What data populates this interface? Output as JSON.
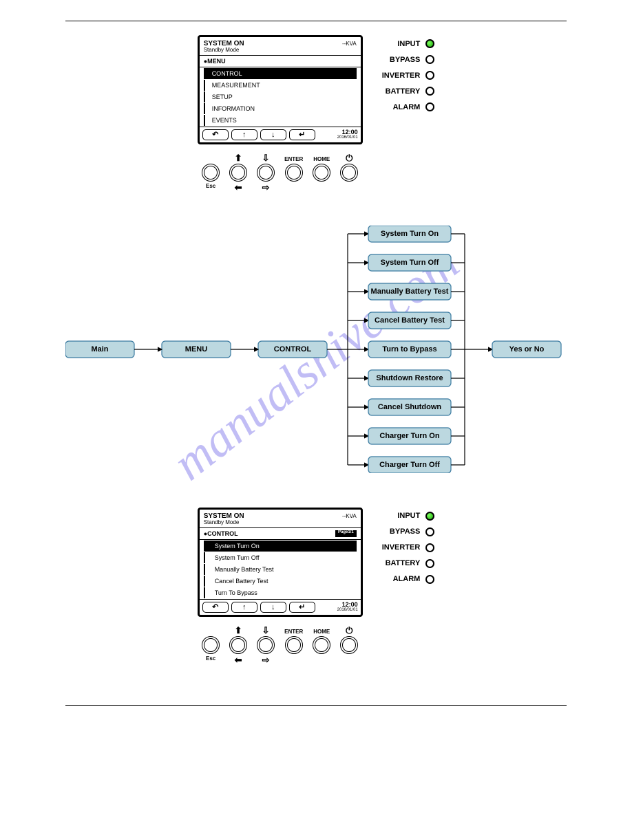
{
  "watermark": "manualshive.com",
  "panel1": {
    "title": "SYSTEM ON",
    "subtitle": "Standby Mode",
    "kva": "--KVA",
    "crumb": "●MENU",
    "pageTag": "",
    "items": [
      {
        "label": "CONTROL",
        "selected": true
      },
      {
        "label": "MEASUREMENT",
        "selected": false
      },
      {
        "label": "SETUP",
        "selected": false
      },
      {
        "label": "INFORMATION",
        "selected": false
      },
      {
        "label": "EVENTS",
        "selected": false
      }
    ],
    "time": "12:00",
    "date": "2016/01/01"
  },
  "panel2": {
    "title": "SYSTEM ON",
    "subtitle": "Standby Mode",
    "kva": "--KVA",
    "crumb": "●CONTROL",
    "pageTag": "Page1/1",
    "items": [
      {
        "label": "System Turn On",
        "selected": true
      },
      {
        "label": "System Turn Off",
        "selected": false
      },
      {
        "label": "Manually Battery Test",
        "selected": false
      },
      {
        "label": "Cancel Battery Test",
        "selected": false
      },
      {
        "label": "Turn To Bypass",
        "selected": false
      }
    ],
    "time": "12:00",
    "date": "2016/01/01"
  },
  "softkeys": [
    "↶",
    "↑",
    "↓",
    "↵"
  ],
  "hardkeys": {
    "k1": {
      "top": "",
      "mid": "Esc",
      "bot": ""
    },
    "k2": {
      "top": "⬆",
      "mid": "",
      "bot": "⬅"
    },
    "k3": {
      "top": "⇩",
      "mid": "",
      "bot": "⇨"
    },
    "k4": {
      "top": "ENTER",
      "mid": "",
      "bot": ""
    },
    "k5": {
      "top": "HOME",
      "mid": "",
      "bot": ""
    },
    "k6": {
      "top": "⏻",
      "mid": "",
      "bot": ""
    }
  },
  "leds": [
    {
      "label": "INPUT",
      "on": true
    },
    {
      "label": "BYPASS",
      "on": false
    },
    {
      "label": "INVERTER",
      "on": false
    },
    {
      "label": "BATTERY",
      "on": false
    },
    {
      "label": "ALARM",
      "on": false
    }
  ],
  "flow": {
    "main": "Main",
    "menu": "MENU",
    "control": "CONTROL",
    "options": [
      "System Turn On",
      "System Turn Off",
      "Manually Battery Test",
      "Cancel Battery Test",
      "Turn to Bypass",
      "Shutdown Restore",
      "Cancel Shutdown",
      "Charger Turn On",
      "Charger Turn Off"
    ],
    "yesno": "Yes or No"
  }
}
